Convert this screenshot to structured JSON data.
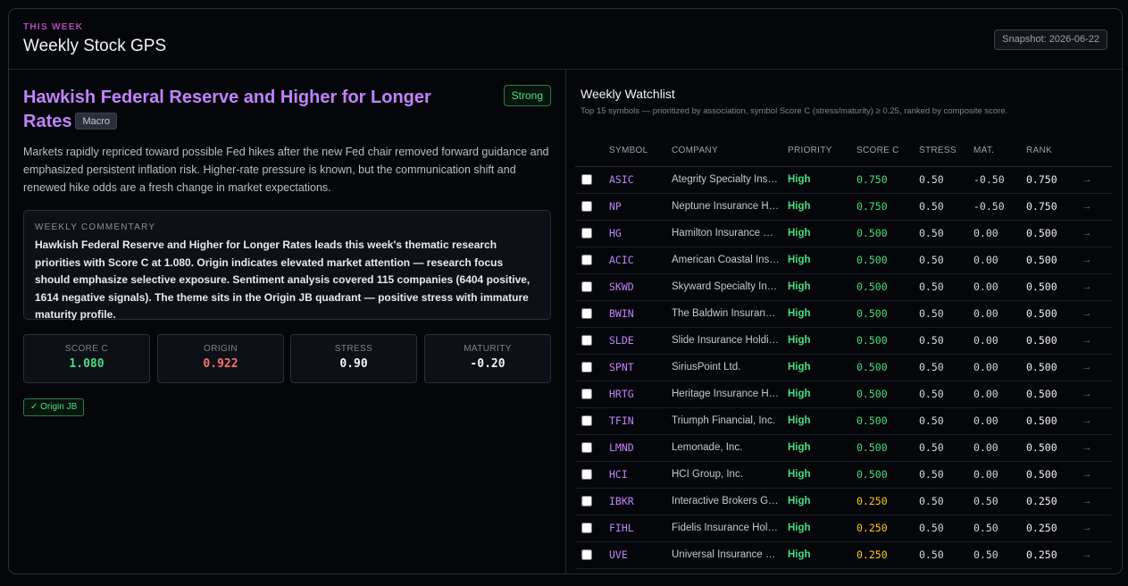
{
  "header": {
    "eyebrow": "THIS WEEK",
    "title": "Weekly Stock GPS",
    "snapshot": "Snapshot: 2026-06-22"
  },
  "theme": {
    "title": "Hawkish Federal Reserve and Higher for Longer Rates",
    "category": "Macro",
    "strength": "Strong",
    "description": "Markets rapidly repriced toward possible Fed hikes after the new Fed chair removed forward guidance and emphasized persistent inflation risk. Higher-rate pressure is known, but the communication shift and renewed hike odds are a fresh change in market expectations.",
    "commentary_label": "WEEKLY COMMENTARY",
    "commentary": "Hawkish Federal Reserve and Higher for Longer Rates leads this week's thematic research priorities with Score C at 1.080. Origin indicates elevated market attention — research focus should emphasize selective exposure. Sentiment analysis covered 115 companies (6404 positive, 1614 negative signals). The theme sits in the Origin JB quadrant — positive stress with immature maturity profile.",
    "metrics": [
      {
        "label": "SCORE C",
        "value": "1.080",
        "color": "#4ade80"
      },
      {
        "label": "ORIGIN",
        "value": "0.922",
        "color": "#f87171"
      },
      {
        "label": "STRESS",
        "value": "0.90",
        "color": "#f2f3f6"
      },
      {
        "label": "MATURITY",
        "value": "-0.20",
        "color": "#f2f3f6"
      }
    ],
    "quadrant_badge": "✓ Origin JB"
  },
  "watchlist": {
    "title": "Weekly Watchlist",
    "subtitle": "Top 15 symbols — prioritized by association, symbol Score C (stress/maturity) ≥ 0.25, ranked by composite score.",
    "columns": [
      "SYMBOL",
      "COMPANY",
      "PRIORITY",
      "SCORE C",
      "STRESS",
      "MAT.",
      "RANK"
    ],
    "more_glyph": "→",
    "rows": [
      {
        "symbol": "ASIC",
        "company": "Ategrity Specialty Insurance Company",
        "priority": "High",
        "score": "0.750",
        "stress": "0.50",
        "mat": "-0.50",
        "rank": "0.750",
        "tone": "g"
      },
      {
        "symbol": "NP",
        "company": "Neptune Insurance Holdings Inc.",
        "priority": "High",
        "score": "0.750",
        "stress": "0.50",
        "mat": "-0.50",
        "rank": "0.750",
        "tone": "g"
      },
      {
        "symbol": "HG",
        "company": "Hamilton Insurance Group, Ltd.",
        "priority": "High",
        "score": "0.500",
        "stress": "0.50",
        "mat": "0.00",
        "rank": "0.500",
        "tone": "g"
      },
      {
        "symbol": "ACIC",
        "company": "American Coastal Insurance Corporation",
        "priority": "High",
        "score": "0.500",
        "stress": "0.50",
        "mat": "0.00",
        "rank": "0.500",
        "tone": "g"
      },
      {
        "symbol": "SKWD",
        "company": "Skyward Specialty Insurance Group",
        "priority": "High",
        "score": "0.500",
        "stress": "0.50",
        "mat": "0.00",
        "rank": "0.500",
        "tone": "g"
      },
      {
        "symbol": "BWIN",
        "company": "The Baldwin Insurance Group, Inc.",
        "priority": "High",
        "score": "0.500",
        "stress": "0.50",
        "mat": "0.00",
        "rank": "0.500",
        "tone": "g"
      },
      {
        "symbol": "SLDE",
        "company": "Slide Insurance Holdings, Inc.",
        "priority": "High",
        "score": "0.500",
        "stress": "0.50",
        "mat": "0.00",
        "rank": "0.500",
        "tone": "g"
      },
      {
        "symbol": "SPNT",
        "company": "SiriusPoint Ltd.",
        "priority": "High",
        "score": "0.500",
        "stress": "0.50",
        "mat": "0.00",
        "rank": "0.500",
        "tone": "g"
      },
      {
        "symbol": "HRTG",
        "company": "Heritage Insurance Holdings, Inc.",
        "priority": "High",
        "score": "0.500",
        "stress": "0.50",
        "mat": "0.00",
        "rank": "0.500",
        "tone": "g"
      },
      {
        "symbol": "TFIN",
        "company": "Triumph Financial, Inc.",
        "priority": "High",
        "score": "0.500",
        "stress": "0.50",
        "mat": "0.00",
        "rank": "0.500",
        "tone": "g"
      },
      {
        "symbol": "LMND",
        "company": "Lemonade, Inc.",
        "priority": "High",
        "score": "0.500",
        "stress": "0.50",
        "mat": "0.00",
        "rank": "0.500",
        "tone": "g"
      },
      {
        "symbol": "HCI",
        "company": "HCI Group, Inc.",
        "priority": "High",
        "score": "0.500",
        "stress": "0.50",
        "mat": "0.00",
        "rank": "0.500",
        "tone": "g"
      },
      {
        "symbol": "IBKR",
        "company": "Interactive Brokers Group, Inc.",
        "priority": "High",
        "score": "0.250",
        "stress": "0.50",
        "mat": "0.50",
        "rank": "0.250",
        "tone": "y"
      },
      {
        "symbol": "FIHL",
        "company": "Fidelis Insurance Holdings Limited",
        "priority": "High",
        "score": "0.250",
        "stress": "0.50",
        "mat": "0.50",
        "rank": "0.250",
        "tone": "y"
      },
      {
        "symbol": "UVE",
        "company": "Universal Insurance Holdings, Inc.",
        "priority": "High",
        "score": "0.250",
        "stress": "0.50",
        "mat": "0.50",
        "rank": "0.250",
        "tone": "y"
      }
    ]
  }
}
